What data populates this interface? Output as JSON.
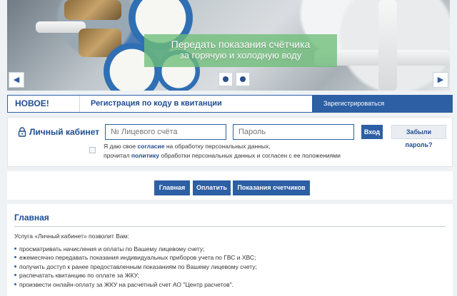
{
  "hero": {
    "caption_line1": "Передать показания счётчика",
    "caption_line2": "за горячую и холодную воду",
    "prev_icon": "triangle-left-icon",
    "next_icon": "triangle-right-icon"
  },
  "news": {
    "badge": "НОВОЕ!",
    "register_by_code": "Регистрация по коду в квитанции",
    "register": "Зарегистрироваться"
  },
  "login": {
    "title": "Личный кабинет",
    "account_placeholder": "№ Лицевого счёта",
    "password_placeholder": "Пароль",
    "enter": "Вход",
    "forgot": "Забыли пароль?",
    "consent_part1": "Я даю свое ",
    "consent_link1": "согласие",
    "consent_part2": " на обработку персональных данных,",
    "consent_part3": "прочитал ",
    "consent_link2": "политику",
    "consent_part4": " обработки персональных данных и согласен с ее положениями"
  },
  "nav": {
    "home": "Главная",
    "pay": "Оплатить",
    "meters": "Показания счетчиков"
  },
  "main": {
    "title": "Главная",
    "intro": "Услуга «Личный кабинет» позволит Вам:",
    "items": [
      "просматривать начисления и оплаты по Вашему лицевому счету;",
      "ежемесячно передавать показания индивидуальных приборов учета по ГВС и ХВС;",
      "получить доступ к ранее предоставленным показаниям по Вашему лицевому счету;",
      "распечатать квитанцию по оплате за ЖКУ;",
      "произвести онлайн-оплату за ЖКУ на расчетный счет АО \"Центр расчетов\"."
    ]
  },
  "colors": {
    "accent": "#2d5fa4",
    "heading": "#1f4c91",
    "caption_bg": "#6ebe78"
  }
}
